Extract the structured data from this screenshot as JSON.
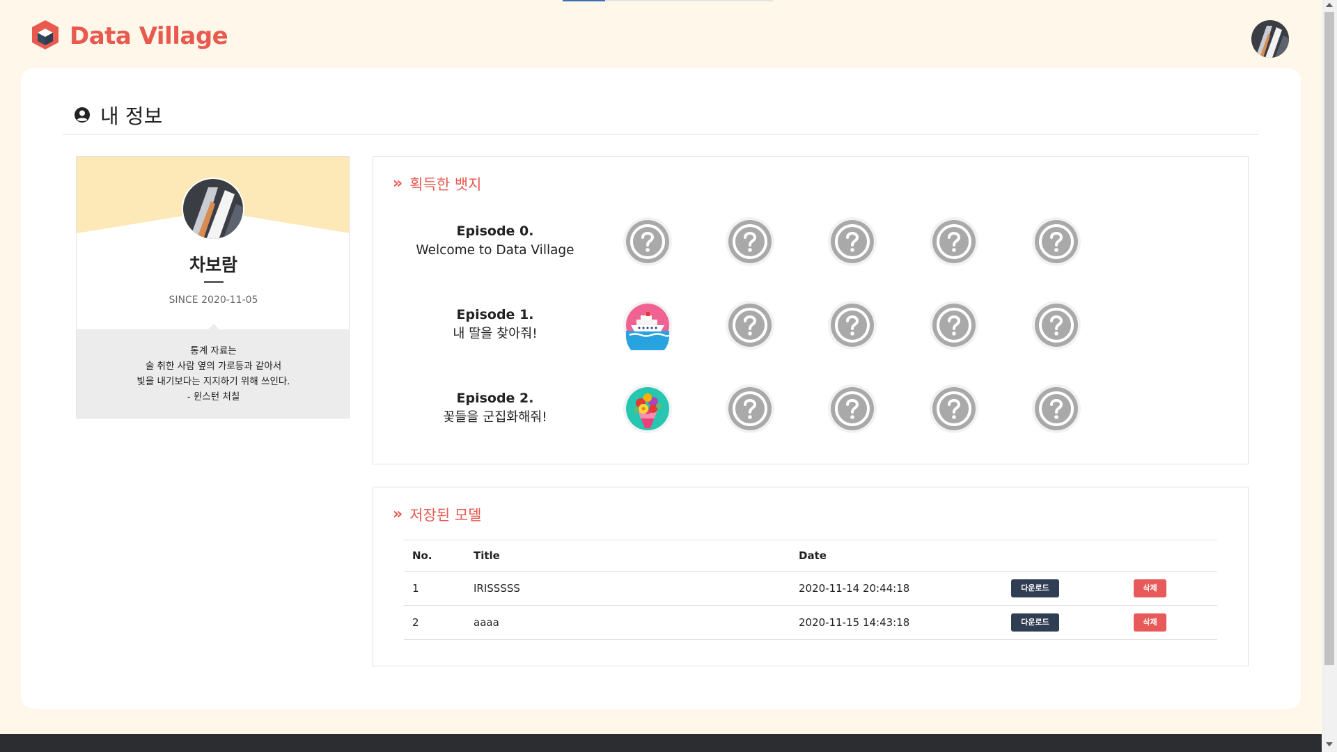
{
  "app": {
    "name": "Data Village",
    "brand_color": "#e85a4f"
  },
  "page": {
    "title": "내 정보",
    "title_icon": "user-circle-icon"
  },
  "profile": {
    "name": "차보람",
    "since": "SINCE 2020-11-05",
    "quote": [
      "통계 자료는",
      "술 취한 사람 옆의 가로등과 같아서",
      "빛을 내기보다는 지지하기 위해 쓰인다.",
      "- 윈스턴 처칠"
    ]
  },
  "badges": {
    "heading": "획득한 뱃지",
    "episodes": [
      {
        "title": "Episode 0.",
        "subtitle": "Welcome to Data Village",
        "badges": [
          "question-badge-icon",
          "question-badge-icon",
          "question-badge-icon",
          "question-badge-icon",
          "question-badge-icon"
        ]
      },
      {
        "title": "Episode 1.",
        "subtitle": "내 딸을 찾아줘!",
        "badges": [
          "cruise-ship-badge-icon",
          "question-badge-icon",
          "question-badge-icon",
          "question-badge-icon",
          "question-badge-icon"
        ]
      },
      {
        "title": "Episode 2.",
        "subtitle": "꽃들을 군집화해줘!",
        "badges": [
          "flower-bouquet-badge-icon",
          "question-badge-icon",
          "question-badge-icon",
          "question-badge-icon",
          "question-badge-icon"
        ]
      }
    ]
  },
  "models": {
    "heading": "저장된 모델",
    "columns": {
      "no": "No.",
      "title": "Title",
      "date": "Date"
    },
    "rows": [
      {
        "no": "1",
        "title": "IRISSSSS",
        "date": "2020-11-14 20:44:18",
        "download_label": "다운로드",
        "delete_label": "삭제"
      },
      {
        "no": "2",
        "title": "aaaa",
        "date": "2020-11-15 14:43:18",
        "download_label": "다운로드",
        "delete_label": "삭제"
      }
    ]
  }
}
